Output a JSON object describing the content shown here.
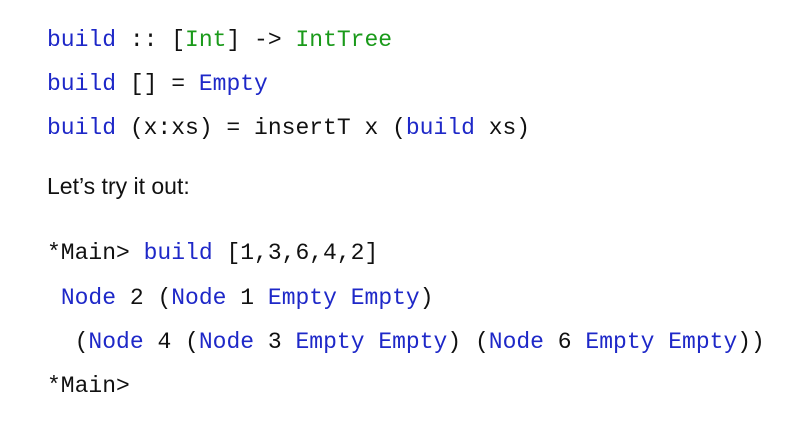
{
  "colors": {
    "blue": "#1e28c8",
    "green": "#1a9a1a",
    "text": "#111111",
    "background": "#ffffff"
  },
  "code_block_1": {
    "line1": {
      "fn": "build",
      "sep1": " :: [",
      "type1": "Int",
      "sep2": "] -> ",
      "type2": "IntTree"
    },
    "line2": {
      "fn": "build",
      "sep1": " [] = ",
      "con": "Empty"
    },
    "line3": {
      "fn": "build",
      "sep1": " (x:xs) = insertT x (",
      "fn2": "build",
      "sep2": " xs)"
    }
  },
  "prose": {
    "text": "Let’s try it out:"
  },
  "repl": {
    "line1": {
      "prompt": "*Main> ",
      "fn": "build",
      "args": " [1,3,6,4,2]"
    },
    "line2": {
      "indent": " ",
      "c1": "Node",
      "t1": " 2 (",
      "c2": "Node",
      "t2": " 1 ",
      "c3": "Empty",
      "t3": " ",
      "c4": "Empty",
      "t4": ")"
    },
    "line3": {
      "indent": "  (",
      "c1": "Node",
      "t1": " 4 (",
      "c2": "Node",
      "t2": " 3 ",
      "c3": "Empty",
      "t3": " ",
      "c4": "Empty",
      "t4": ") (",
      "c5": "Node",
      "t5": " 6 ",
      "c6": "Empty",
      "t6": " ",
      "c7": "Empty",
      "t7": "))"
    },
    "line4": {
      "prompt": "*Main>"
    }
  }
}
